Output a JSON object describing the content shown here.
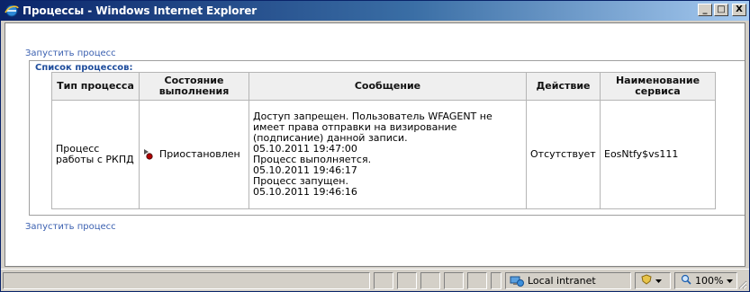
{
  "window": {
    "title": "Процессы - Windows Internet Explorer",
    "minimize_label": "_",
    "maximize_label": "□",
    "close_label": "X"
  },
  "links": {
    "run_process_top": "Запустить процесс",
    "run_process_bottom": "Запустить процесс"
  },
  "process_list": {
    "caption": "Список процессов:",
    "columns": [
      "Тип процесса",
      "Состояние выполнения",
      "Сообщение",
      "Действие",
      "Наименование сервиса"
    ],
    "rows": [
      {
        "type": "Процесс работы с РКПД",
        "state": "Приостановлен",
        "message_lines": [
          "Доступ запрещен. Пользователь WFAGENT не",
          "имеет права отправки на визирование",
          "(подписание) данной записи.",
          "05.10.2011 19:47:00",
          "Процесс выполняется.",
          "05.10.2011 19:46:17",
          "Процесс запущен.",
          "05.10.2011 19:46:16"
        ],
        "action": "Отсутствует",
        "service": "EosNtfy$vs111"
      }
    ]
  },
  "statusbar": {
    "zone": "Local intranet",
    "zoom": "100%"
  },
  "icons": {
    "title": "internet-explorer-icon",
    "state": "paused-state-icon",
    "zone": "local-intranet-icon",
    "protected": "protected-mode-icon",
    "zoom": "zoom-icon"
  },
  "colors": {
    "titlebar_start": "#0a246a",
    "titlebar_end": "#a6caf0",
    "link": "#3b60b0",
    "caption": "#1f4d9c",
    "header_bg": "#efefef",
    "chrome": "#d4d0c8"
  }
}
